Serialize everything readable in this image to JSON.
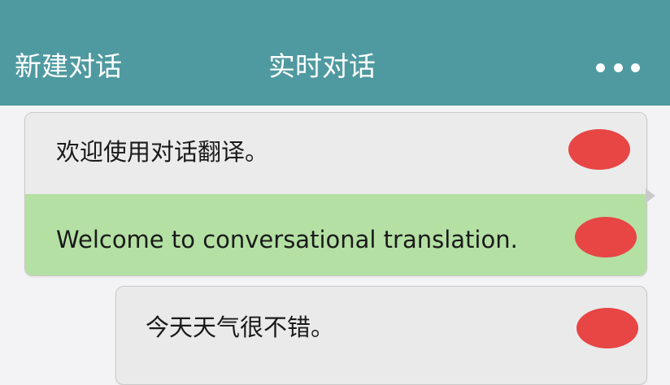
{
  "header": {
    "new_conversation_label": "新建对话",
    "title": "实时对话",
    "more_icon": "more-dots-icon"
  },
  "messages": [
    {
      "source_text": "欢迎使用对话翻译。",
      "translation_text": "Welcome to conversational translation."
    },
    {
      "source_text": "今天天气很不错。"
    }
  ],
  "colors": {
    "header": "#4f9aa0",
    "source_bubble": "#ebebeb",
    "translation_bubble": "#b4e0a4",
    "redaction": "#e84545"
  }
}
